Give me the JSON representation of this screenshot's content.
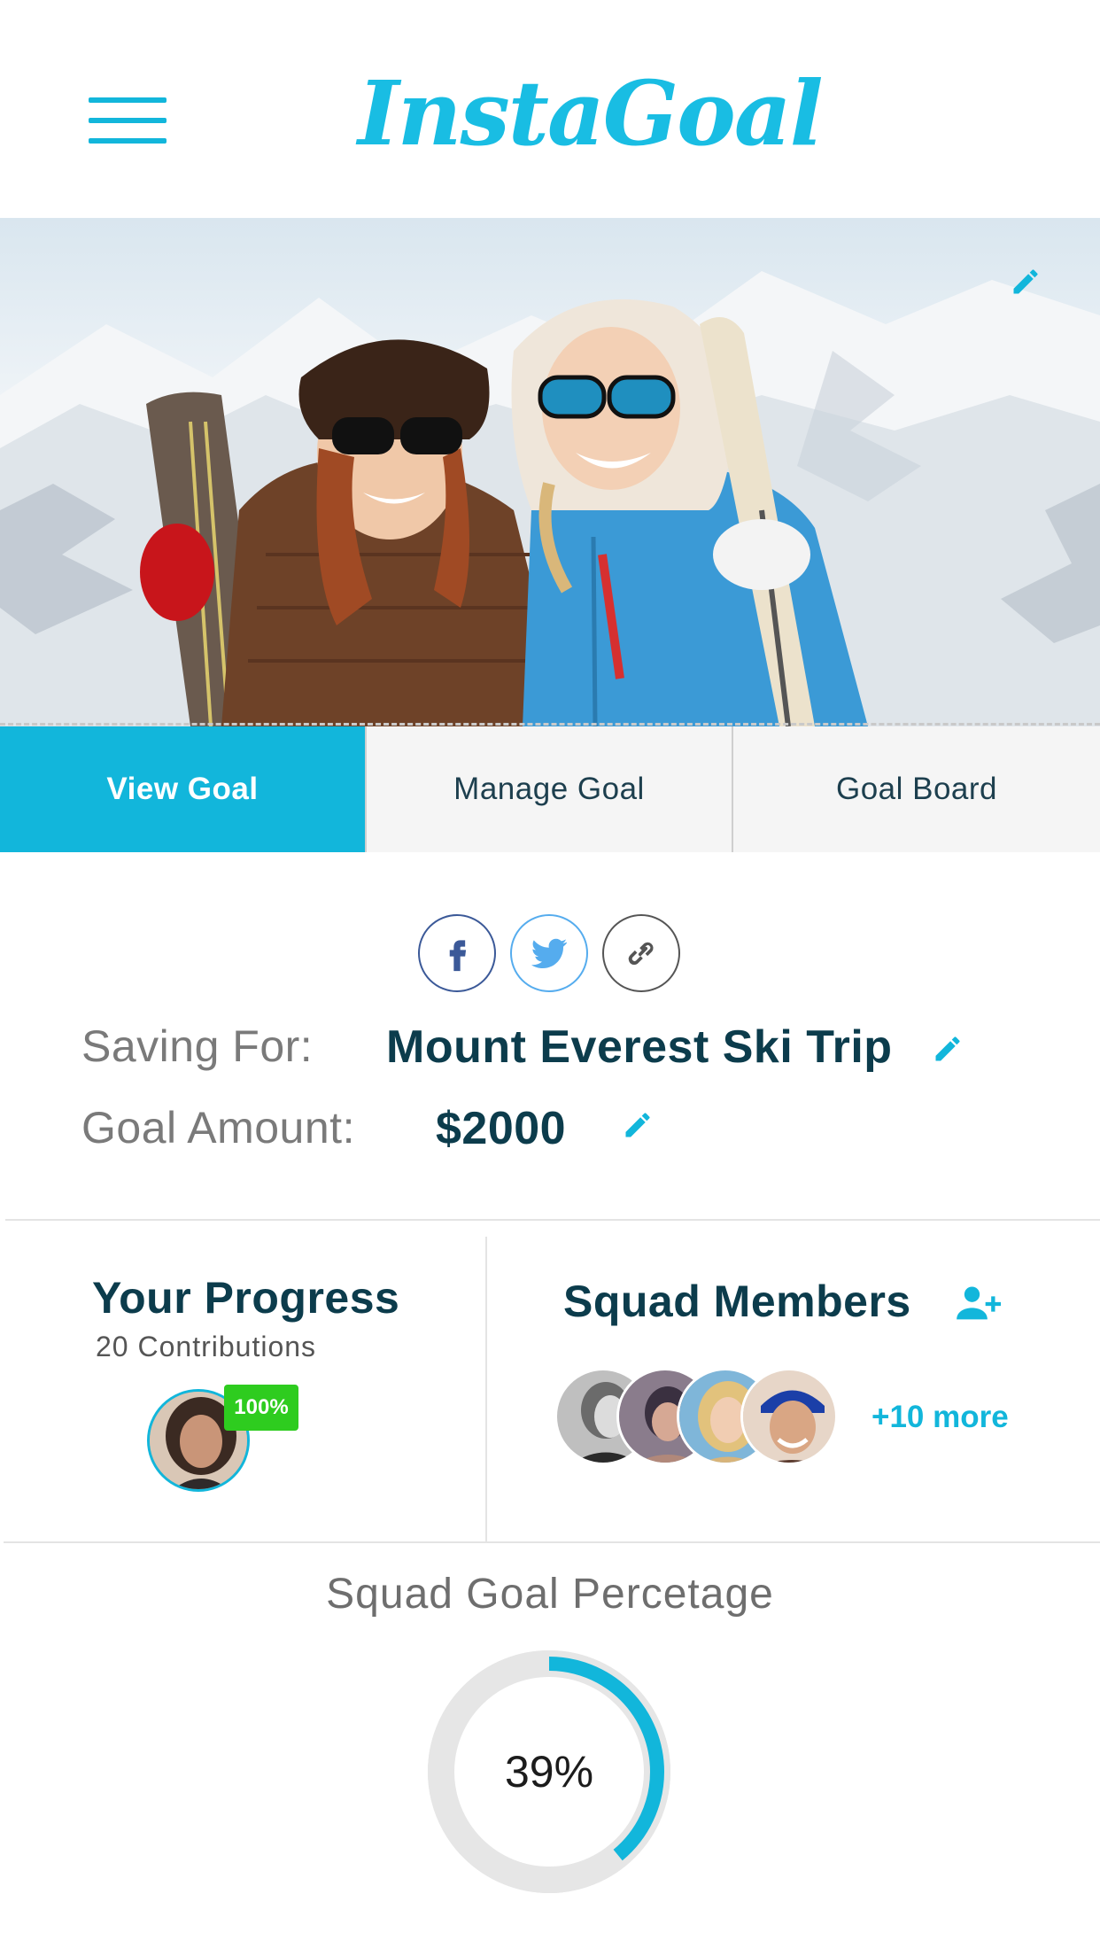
{
  "app": {
    "title": "InstaGoal"
  },
  "colors": {
    "accent": "#12b6db",
    "dark_text": "#0c3c4c",
    "badge_green": "#2ecc1f"
  },
  "header": {
    "menu_icon": "hamburger-menu-icon",
    "logo_text": "InstaGoal"
  },
  "hero": {
    "edit_icon": "pencil-icon"
  },
  "tabs": [
    {
      "label": "View Goal",
      "active": true
    },
    {
      "label": "Manage Goal",
      "active": false
    },
    {
      "label": "Goal Board",
      "active": false
    }
  ],
  "share": {
    "icons": [
      "facebook-icon",
      "twitter-icon",
      "link-icon"
    ]
  },
  "goal": {
    "saving_for_label": "Saving For:",
    "saving_for_value": "Mount Everest Ski Trip",
    "amount_label": "Goal Amount:",
    "amount_value": "$2000"
  },
  "progress": {
    "title": "Your Progress",
    "contributions": "20 Contributions",
    "badge": "100%"
  },
  "squad": {
    "title": "Squad Members",
    "more": "+10 more",
    "add_icon": "add-user-icon"
  },
  "squad_goal": {
    "title": "Squad Goal Percetage",
    "percent_label": "39%",
    "percent_value": 39
  }
}
